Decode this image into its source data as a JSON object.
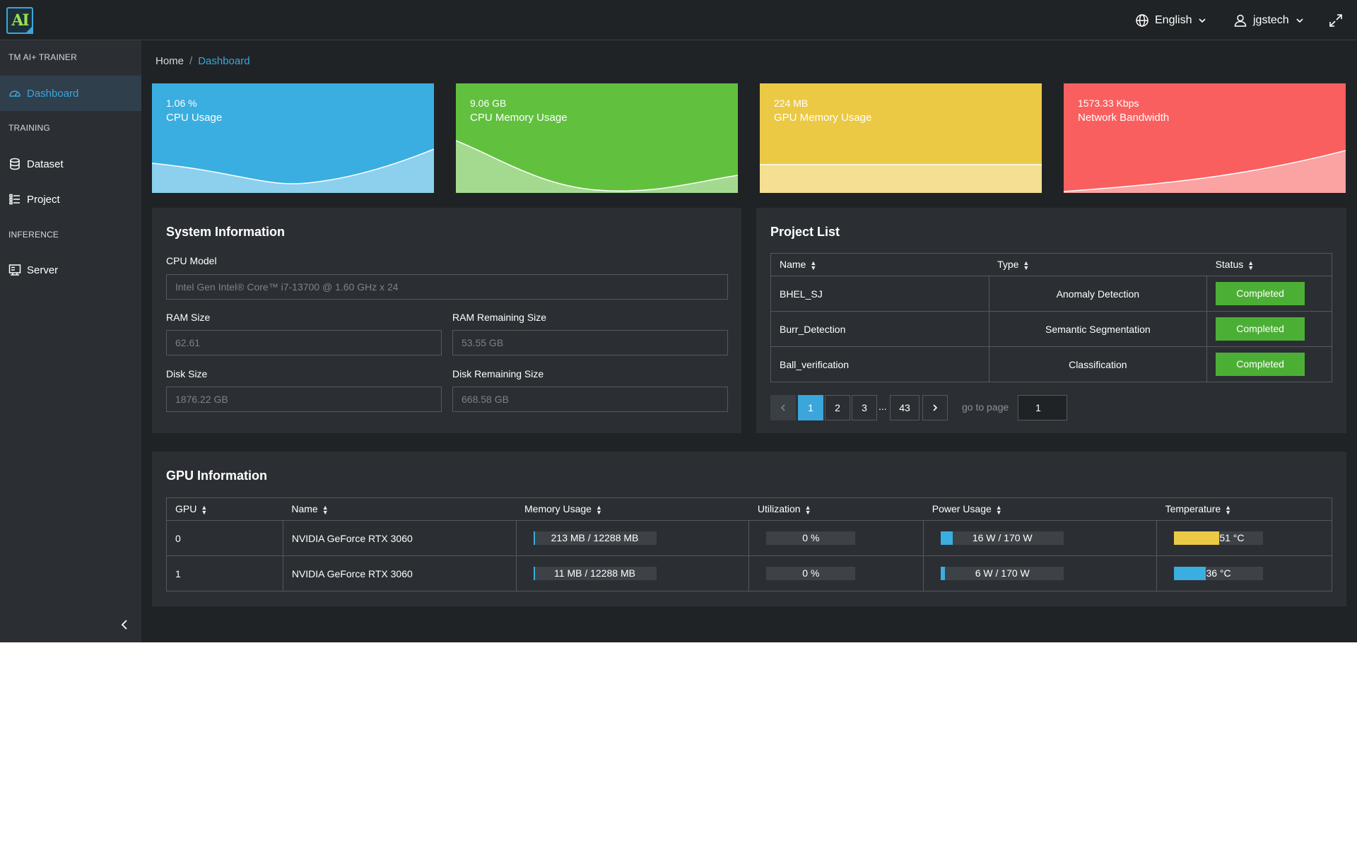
{
  "header": {
    "language": "English",
    "username": "jgstech",
    "logo_text": "AI"
  },
  "sidebar": {
    "app_section": "TM AI+ TRAINER",
    "training_section": "TRAINING",
    "inference_section": "INFERENCE",
    "items": [
      {
        "label": "Dashboard",
        "icon": "dashboard-icon",
        "active": true
      },
      {
        "label": "Dataset",
        "icon": "database-icon"
      },
      {
        "label": "Project",
        "icon": "list-icon"
      },
      {
        "label": "Server",
        "icon": "server-icon"
      }
    ]
  },
  "breadcrumb": {
    "home": "Home",
    "current": "Dashboard"
  },
  "stats": [
    {
      "value": "1.06 %",
      "label": "CPU Usage",
      "color": "#3aaee0"
    },
    {
      "value": "9.06 GB",
      "label": "CPU Memory Usage",
      "color": "#62c03f"
    },
    {
      "value": "224 MB",
      "label": "GPU Memory Usage",
      "color": "#ecc944"
    },
    {
      "value": "1573.33 Kbps",
      "label": "Network Bandwidth",
      "color": "#f95f5f"
    }
  ],
  "system_info": {
    "title": "System Information",
    "cpu_model_label": "CPU Model",
    "cpu_model": "Intel Gen Intel® Core™ i7-13700 @ 1.60 GHz x 24",
    "ram_size_label": "RAM Size",
    "ram_size": "62.61",
    "ram_remaining_label": "RAM Remaining Size",
    "ram_remaining": "53.55 GB",
    "disk_size_label": "Disk Size",
    "disk_size": "1876.22 GB",
    "disk_remaining_label": "Disk Remaining Size",
    "disk_remaining": "668.58 GB"
  },
  "project_list": {
    "title": "Project List",
    "columns": [
      "Name",
      "Type",
      "Status"
    ],
    "rows": [
      {
        "name": "BHEL_SJ",
        "type": "Anomaly Detection",
        "status": "Completed"
      },
      {
        "name": "Burr_Detection",
        "type": "Semantic Segmentation",
        "status": "Completed"
      },
      {
        "name": "Ball_verification",
        "type": "Classification",
        "status": "Completed"
      }
    ],
    "pagination": {
      "pages": [
        "1",
        "2",
        "3"
      ],
      "ellipsis": "...",
      "last_page": "43",
      "current": 1,
      "goto_label": "go to page",
      "goto_value": "1"
    }
  },
  "gpu_info": {
    "title": "GPU Information",
    "columns": [
      "GPU",
      "Name",
      "Memory Usage",
      "Utilization",
      "Power Usage",
      "Temperature"
    ],
    "rows": [
      {
        "gpu": "0",
        "name": "NVIDIA GeForce RTX 3060",
        "memory": "213 MB / 12288 MB",
        "memory_pct": 1.7,
        "utilization": "0 %",
        "utilization_pct": 0,
        "power": "16 W / 170 W",
        "power_pct": 9.4,
        "temperature": "51 °C",
        "temperature_pct": 51,
        "temperature_color": "#ecc944"
      },
      {
        "gpu": "1",
        "name": "NVIDIA GeForce RTX 3060",
        "memory": "11 MB / 12288 MB",
        "memory_pct": 0.1,
        "utilization": "0 %",
        "utilization_pct": 0,
        "power": "6 W / 170 W",
        "power_pct": 3.5,
        "temperature": "36 °C",
        "temperature_pct": 36,
        "temperature_color": "#3aaee0"
      }
    ],
    "bar_color": "#3aaee0"
  }
}
